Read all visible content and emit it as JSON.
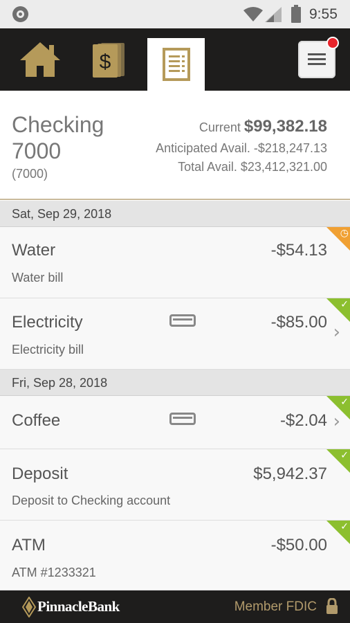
{
  "status_bar": {
    "time": "9:55",
    "icons": [
      "record-icon",
      "wifi-icon",
      "signal-icon",
      "battery-icon"
    ]
  },
  "nav": {
    "tabs": [
      {
        "name": "home",
        "icon": "home-icon"
      },
      {
        "name": "money",
        "icon": "dollar-icon"
      },
      {
        "name": "transactions",
        "icon": "document-icon",
        "active": true
      }
    ],
    "menu_icon": "menu-icon",
    "accent_color": "#b59a5a"
  },
  "account": {
    "name": "Checking 7000",
    "number": "(7000)",
    "current_label": "Current",
    "current_value": "$99,382.18",
    "anticipated": "Anticipated Avail. -$218,247.13",
    "total": "Total Avail. $23,412,321.00"
  },
  "groups": [
    {
      "date": "Sat, Sep 29, 2018",
      "transactions": [
        {
          "name": "Water",
          "description": "Water bill",
          "amount": "-$54.13",
          "status": "pending"
        },
        {
          "name": "Electricity",
          "description": "Electricity bill",
          "amount": "-$85.00",
          "status": "cleared"
        }
      ]
    },
    {
      "date": "Fri, Sep 28, 2018",
      "transactions": [
        {
          "name": "Coffee",
          "description": "",
          "amount": "-$2.04",
          "status": "cleared"
        },
        {
          "name": "Deposit",
          "description": "Deposit to Checking account",
          "amount": "$5,942.37",
          "status": "cleared"
        },
        {
          "name": "ATM",
          "description": "ATM #1233321",
          "amount": "-$50.00",
          "status": "cleared"
        }
      ]
    }
  ],
  "footer": {
    "brand": "PinnacleBank",
    "fdic": "Member FDIC"
  },
  "colors": {
    "status_cleared": "#8cbf2f",
    "status_pending": "#f0a033"
  }
}
